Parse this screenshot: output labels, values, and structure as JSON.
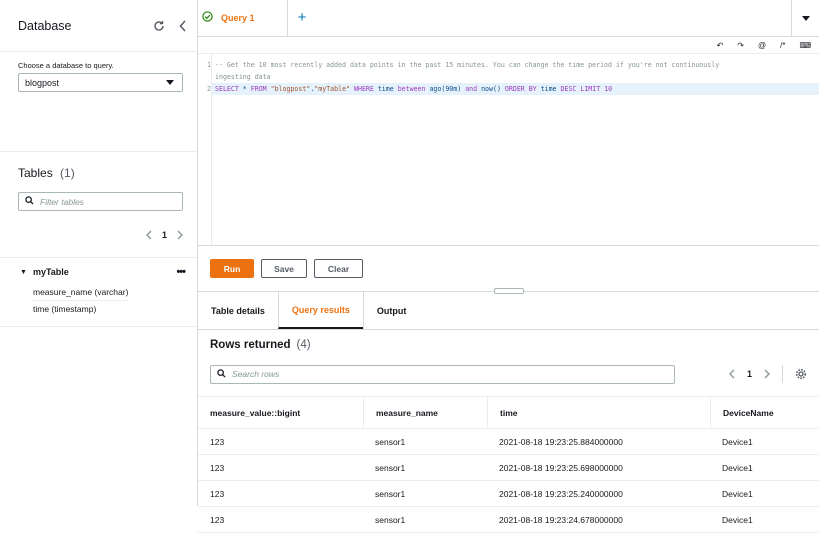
{
  "sidebar": {
    "title": "Database",
    "db_label": "Choose a database to query.",
    "db_value": "blogpost",
    "tables_title": "Tables",
    "tables_count": "(1)",
    "filter_placeholder": "Filter tables",
    "page": "1",
    "table": {
      "name": "myTable",
      "columns": [
        "measure_name (varchar)",
        "time (timestamp)"
      ]
    }
  },
  "tabs": {
    "query_tab": "Query 1",
    "add": "+"
  },
  "toolbar": {
    "undo": "↶",
    "redo": "↷",
    "at": "@",
    "comment": "/*",
    "keyboard": "⌨"
  },
  "editor": {
    "line_numbers": [
      "1",
      "2"
    ],
    "comment_line_a": "-- Get the 10 most recently added data points in the past 15 minutes. You can change the time period if you're not continuously",
    "comment_line_b": "ingesting data",
    "q": {
      "select": "SELECT",
      "star": " * ",
      "from": "FROM",
      "db": " \"blogpost\"",
      "dot": ".",
      "tbl": "\"myTable\"",
      "where": " WHERE",
      "time1": " time",
      "between": " between",
      "ago": " ago(90m)",
      "and": " and",
      "now": " now()",
      "order": " ORDER BY",
      "time2": " time",
      "desc": " DESC LIMIT 10"
    }
  },
  "actions": {
    "run": "Run",
    "save": "Save",
    "clear": "Clear"
  },
  "result_tabs": [
    "Table details",
    "Query results",
    "Output"
  ],
  "results": {
    "title": "Rows returned",
    "count": "(4)",
    "search_placeholder": "Search rows",
    "page": "1",
    "columns": [
      "measure_value::bigint",
      "measure_name",
      "time",
      "DeviceName"
    ],
    "rows": [
      [
        "123",
        "sensor1",
        "2021-08-18 19:23:25.884000000",
        "Device1"
      ],
      [
        "123",
        "sensor1",
        "2021-08-18 19:23:25.698000000",
        "Device1"
      ],
      [
        "123",
        "sensor1",
        "2021-08-18 19:23:25.240000000",
        "Device1"
      ],
      [
        "123",
        "sensor1",
        "2021-08-18 19:23:24.678000000",
        "Device1"
      ]
    ]
  }
}
